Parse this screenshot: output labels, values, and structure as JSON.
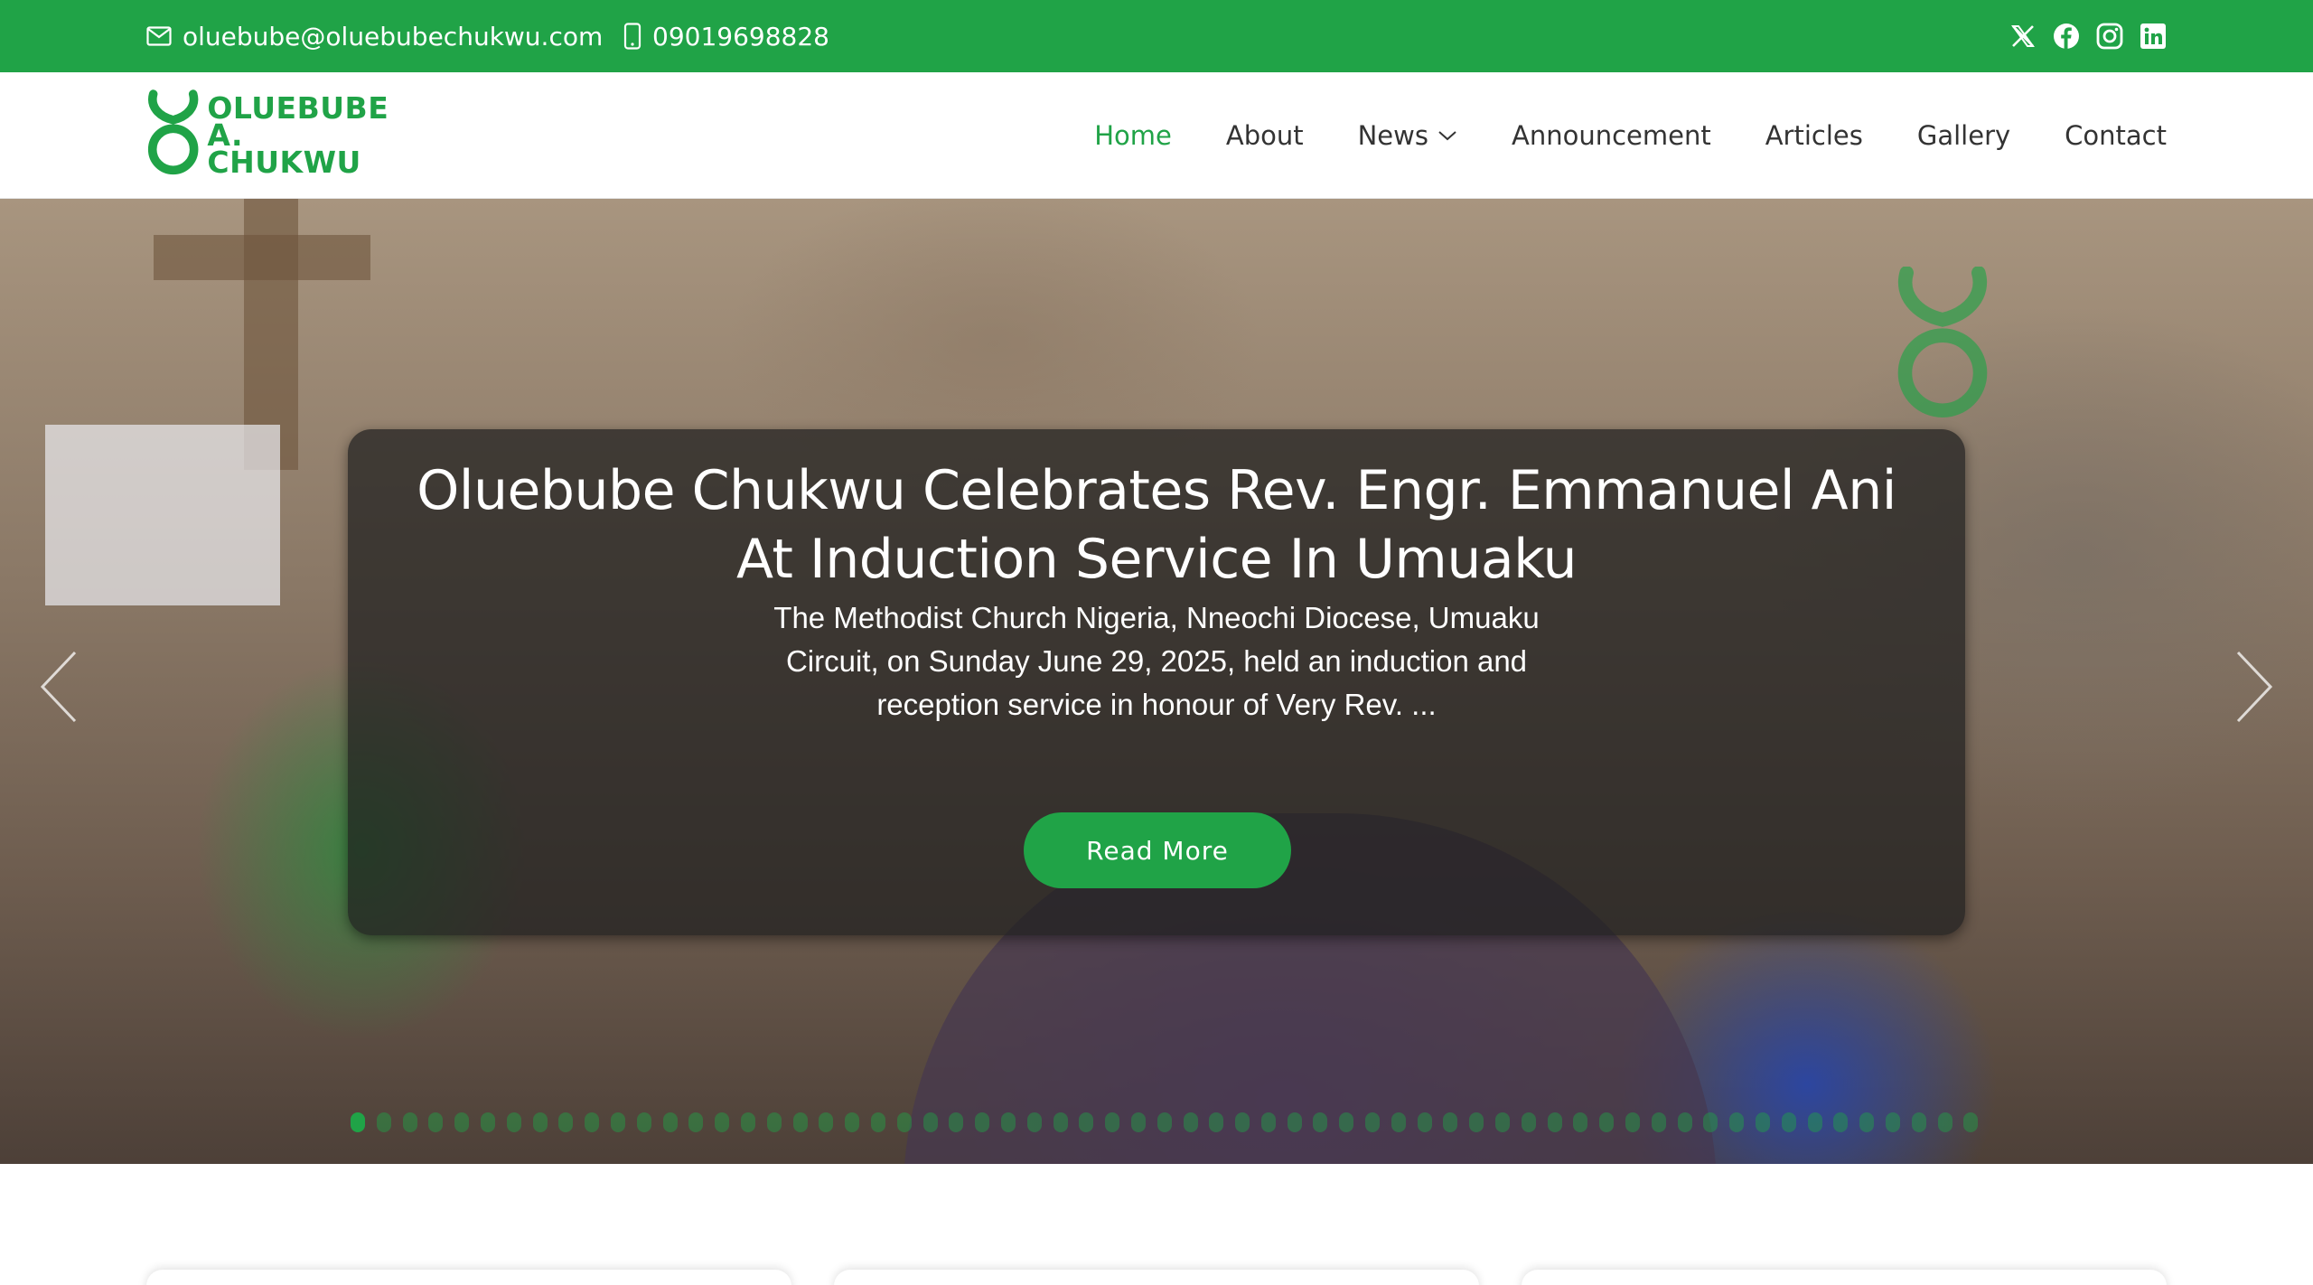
{
  "topbar": {
    "email": "oluebube@oluebubechukwu.com",
    "phone": "09019698828",
    "socials": [
      "x-icon",
      "facebook-icon",
      "instagram-icon",
      "linkedin-icon"
    ]
  },
  "header": {
    "logo_line1": "OLUEBUBE",
    "logo_line2": "A. CHUKWU",
    "nav": [
      "Home",
      "About",
      "News",
      "Announcement",
      "Articles",
      "Gallery",
      "Contact"
    ],
    "active_nav": "Home"
  },
  "hero": {
    "title": "Oluebube Chukwu Celebrates Rev. Engr. Emmanuel Ani At Induction Service In Umuaku",
    "excerpt": "The Methodist Church Nigeria, Nneochi Diocese, Umuaku Circuit, on Sunday June 29, 2025, held an induction and reception service in honour of Very Rev. ...",
    "button_label": "Read More",
    "watermark_text": "OLUEBUBE A. CHUKWU",
    "slide_count": 63,
    "active_slide": 1
  },
  "colors": {
    "brand_green": "#20a347",
    "text_dark": "#333333"
  }
}
